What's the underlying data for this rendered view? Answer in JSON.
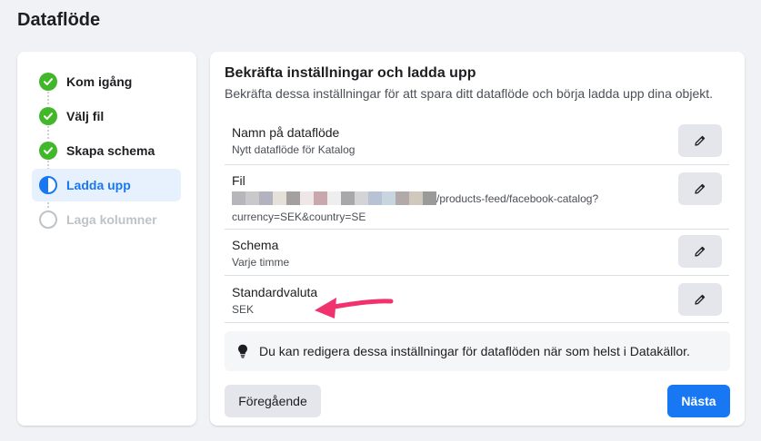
{
  "page": {
    "title": "Dataflöde"
  },
  "steps": [
    {
      "label": "Kom igång",
      "state": "done"
    },
    {
      "label": "Välj fil",
      "state": "done"
    },
    {
      "label": "Skapa schema",
      "state": "done"
    },
    {
      "label": "Ladda upp",
      "state": "active"
    },
    {
      "label": "Laga kolumner",
      "state": "pending"
    }
  ],
  "main": {
    "title": "Bekräfta inställningar och ladda upp",
    "subtitle": "Bekräfta dessa inställningar för att spara ditt dataflöde och börja ladda upp dina objekt.",
    "rows": [
      {
        "label": "Namn på dataflöde",
        "value": "Nytt dataflöde för Katalog"
      },
      {
        "label": "Fil",
        "value_line1": "/products-feed/facebook-catalog?",
        "value_line2": "currency=SEK&country=SE"
      },
      {
        "label": "Schema",
        "value": "Varje timme"
      },
      {
        "label": "Standardvaluta",
        "value": "SEK"
      }
    ],
    "info": "Du kan redigera dessa inställningar för dataflöden när som helst i Datakällor."
  },
  "buttons": {
    "previous": "Föregående",
    "next": "Nästa"
  },
  "colors": {
    "accent": "#1877f2",
    "success": "#42b72a",
    "annotation_arrow": "#f0326e"
  },
  "icons": {
    "step_done": "check-circle-icon",
    "step_active": "half-circle-icon",
    "step_pending": "empty-circle-icon",
    "edit": "pencil-icon",
    "info": "lightbulb-icon"
  }
}
